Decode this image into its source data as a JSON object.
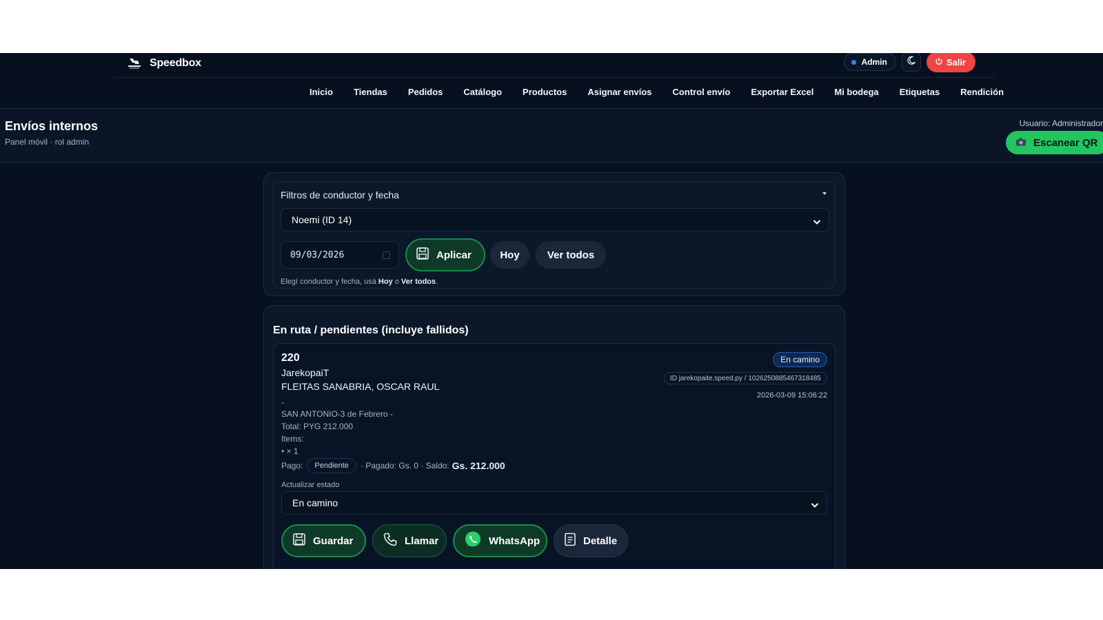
{
  "app": {
    "brand": "Speedbox",
    "admin_label": "Admin",
    "exit_label": "Salir"
  },
  "nav": {
    "items": [
      "Inicio",
      "Tiendas",
      "Pedidos",
      "Catálogo",
      "Productos",
      "Asignar envíos",
      "Control envío",
      "Exportar Excel",
      "Mi bodega",
      "Etiquetas",
      "Rendición"
    ]
  },
  "header": {
    "title": "Envíos internos",
    "subtitle": "Panel móvil · rol admin",
    "user_label": "Usuario: Administrador",
    "scan_label": "Escanear QR"
  },
  "filters": {
    "title": "Filtros de conductor y fecha",
    "driver_selected": "Noemi (ID 14)",
    "date_value": "09/03/2026",
    "apply_label": "Aplicar",
    "today_label": "Hoy",
    "all_label": "Ver todos",
    "hint_prefix": "Elegí conductor y fecha, usá ",
    "hint_today": "Hoy",
    "hint_mid": " o ",
    "hint_all": "Ver todos",
    "hint_suffix": "."
  },
  "orders": {
    "title": "En ruta / pendientes (incluye fallidos)",
    "items": [
      {
        "number": "220",
        "store": "JarekopaiT",
        "customer": "FLEITAS SANABRIA, OSCAR RAUL",
        "dash": "-",
        "address": "SAN ANTONIO-3 de Febrero -",
        "total": "Total: PYG 212.000",
        "items_label": "Items:",
        "item_line": "• × 1",
        "status_badge": "En camino",
        "id_badge": "ID jarekopaite.speed.py / 1026250885467318485",
        "date": "2026-03-09 15:06:22",
        "pay_label": "Pago:",
        "pay_status": "Pendiente",
        "paid_text": "· Pagado: Gs. 0 · Saldo:",
        "saldo": "Gs. 212.000",
        "update_label": "Actualizar estado",
        "update_selected": "En camino",
        "actions": {
          "save": "Guardar",
          "call": "Llamar",
          "whatsapp": "WhatsApp",
          "detail": "Detalle"
        }
      }
    ]
  },
  "colors": {
    "background": "#06101f",
    "accent_green": "#22c55e",
    "danger": "#ef4444",
    "status_blue": "#2b5aa8"
  },
  "icons": [
    "speedbox-logo-icon",
    "status-dot-icon",
    "moon-icon",
    "power-icon",
    "camera-icon",
    "chevron-down-icon",
    "calendar-icon",
    "save-icon",
    "phone-icon",
    "whatsapp-icon",
    "document-icon"
  ]
}
